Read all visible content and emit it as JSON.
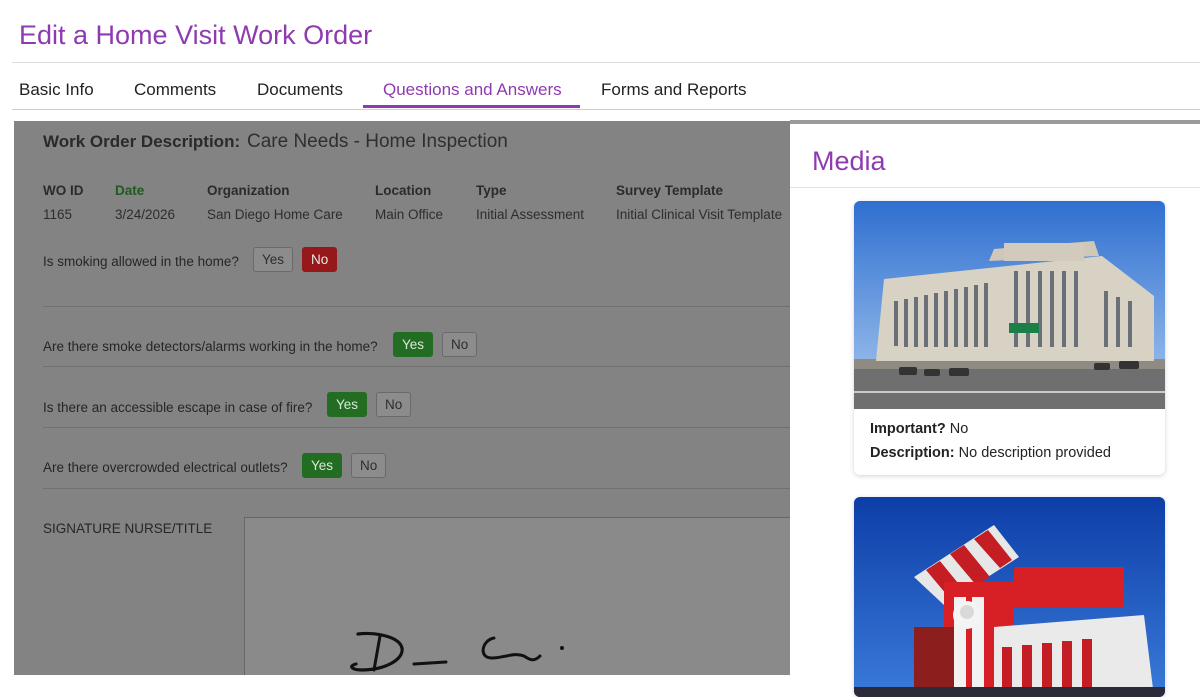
{
  "page": {
    "title": "Edit a Home Visit Work Order"
  },
  "tabs": [
    {
      "label": "Basic Info",
      "active": false
    },
    {
      "label": "Comments",
      "active": false
    },
    {
      "label": "Documents",
      "active": false
    },
    {
      "label": "Questions and Answers",
      "active": true
    },
    {
      "label": "Forms and Reports",
      "active": false
    }
  ],
  "work_order": {
    "description_label": "Work Order Description:",
    "description_value": "Care Needs - Home Inspection",
    "columns": [
      {
        "header": "WO ID",
        "value": "1165"
      },
      {
        "header": "Date",
        "value": "3/24/2026"
      },
      {
        "header": "Organization",
        "value": "San Diego Home Care"
      },
      {
        "header": "Location",
        "value": "Main Office"
      },
      {
        "header": "Type",
        "value": "Initial Assessment"
      },
      {
        "header": "Survey Template",
        "value": "Initial Clinical Visit Template"
      }
    ]
  },
  "questions": [
    {
      "text": "Is smoking allowed in the home?",
      "yes": "Yes",
      "no": "No",
      "answer": "No"
    },
    {
      "text": "Are there smoke detectors/alarms working in the home?",
      "yes": "Yes",
      "no": "No",
      "answer": "Yes"
    },
    {
      "text": "Is there an accessible escape in case of fire?",
      "yes": "Yes",
      "no": "No",
      "answer": "Yes"
    },
    {
      "text": "Are there overcrowded electrical outlets?",
      "yes": "Yes",
      "no": "No",
      "answer": "Yes"
    }
  ],
  "signature": {
    "label": "SIGNATURE NURSE/TITLE"
  },
  "media": {
    "title": "Media",
    "items": [
      {
        "icon": "building-photo",
        "important_label": "Important?",
        "important_value": "No",
        "description_label": "Description:",
        "description_value": "No description provided"
      },
      {
        "icon": "kfc-restaurant-photo"
      }
    ]
  },
  "colors": {
    "accent": "#8e3bb0",
    "no_selected": "#971818",
    "yes_selected": "#226d22",
    "overlay": "#838383"
  }
}
